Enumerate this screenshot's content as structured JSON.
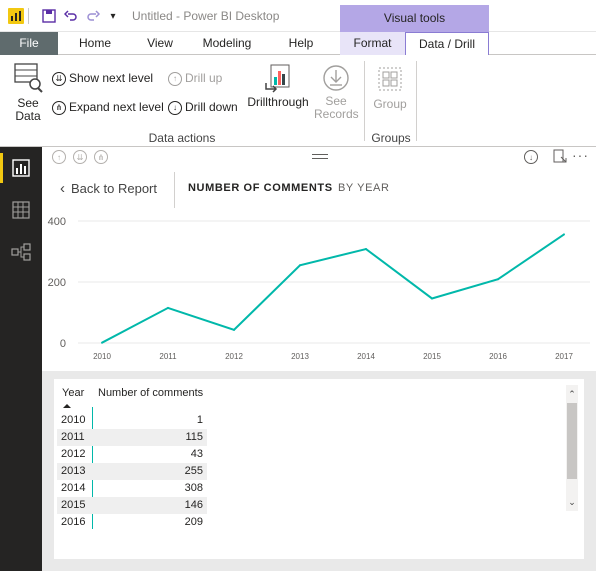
{
  "window": {
    "title": "Untitled - Power BI Desktop"
  },
  "contextual_group": "Visual tools",
  "tabs": [
    "File",
    "Home",
    "View",
    "Modeling",
    "Help",
    "Format",
    "Data / Drill"
  ],
  "ribbon": {
    "see_data": [
      "See",
      "Data"
    ],
    "show_next_level": "Show next level",
    "expand_next_level": "Expand next level",
    "drill_up": "Drill up",
    "drill_down": "Drill down",
    "drillthrough": "Drillthrough",
    "see_records": [
      "See",
      "Records"
    ],
    "group": "Group",
    "group_labels": {
      "data_actions": "Data actions",
      "groups": "Groups"
    }
  },
  "visual": {
    "back_label": "Back to Report",
    "breadcrumb_measure": "NUMBER OF COMMENTS",
    "breadcrumb_axis": "BY YEAR"
  },
  "chart_data": {
    "type": "line",
    "x": [
      "2010",
      "2011",
      "2012",
      "2013",
      "2014",
      "2015",
      "2016",
      "2017"
    ],
    "series": [
      {
        "values": [
          1,
          115,
          43,
          255,
          308,
          146,
          209,
          356
        ]
      }
    ],
    "yticks": [
      0,
      200,
      400
    ],
    "ylim": [
      0,
      400
    ],
    "grid": true,
    "color": "#01b8aa"
  },
  "table": {
    "headers": [
      "Year",
      "Number of comments"
    ],
    "rows": [
      [
        "2010",
        "1"
      ],
      [
        "2011",
        "115"
      ],
      [
        "2012",
        "43"
      ],
      [
        "2013",
        "255"
      ],
      [
        "2014",
        "308"
      ],
      [
        "2015",
        "146"
      ],
      [
        "2016",
        "209"
      ]
    ]
  },
  "colors": {
    "accent": "#f2c811",
    "series": "#01b8aa",
    "visual_tools": "#b4a7e6",
    "nav_bg": "#252423"
  }
}
